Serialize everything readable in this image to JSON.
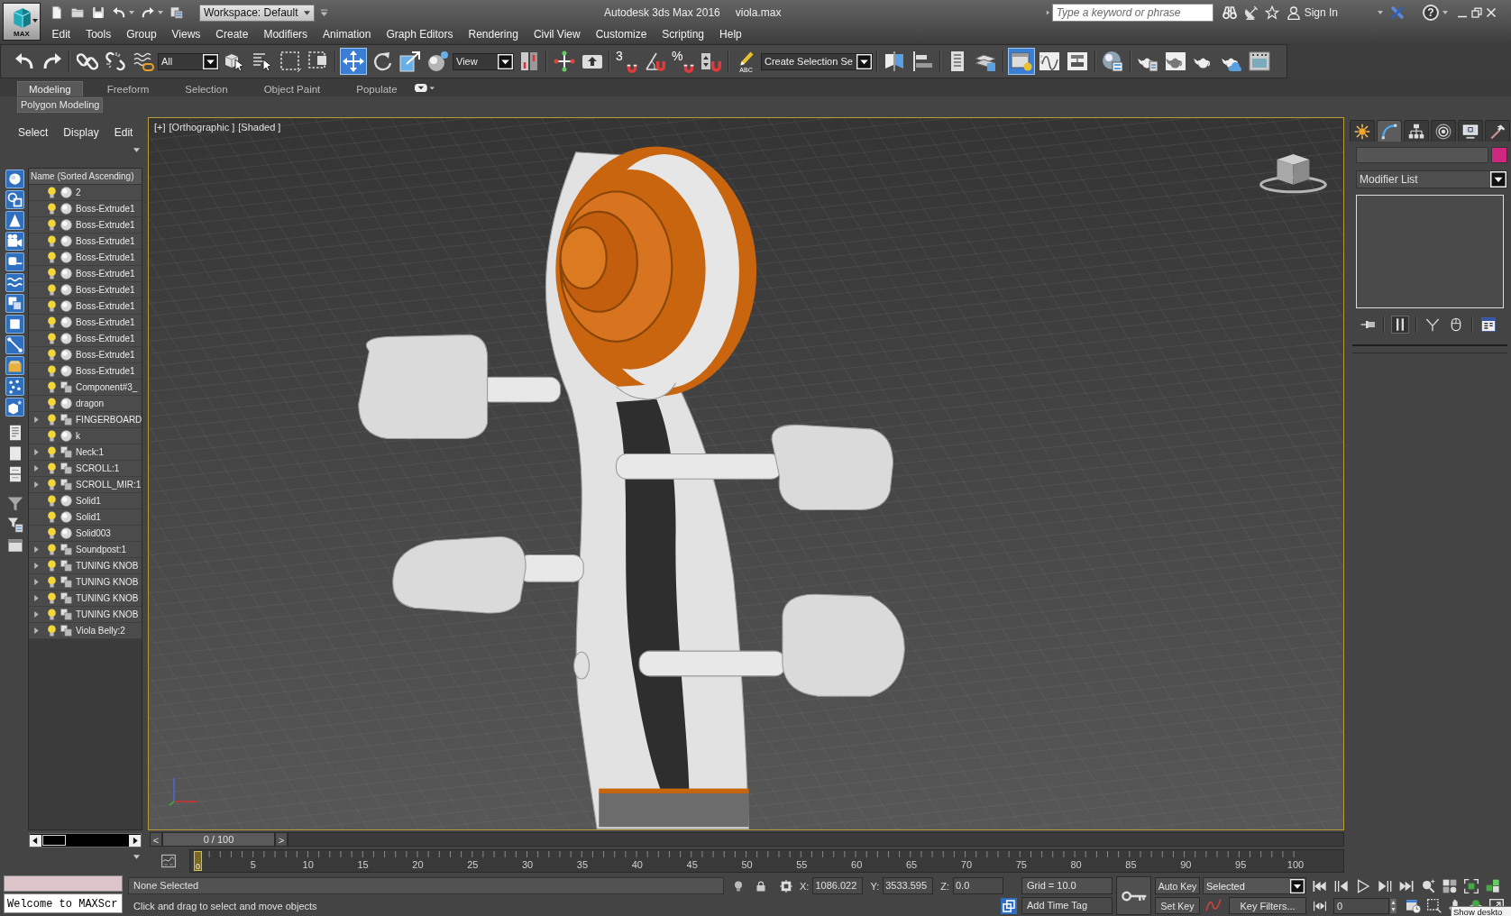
{
  "title_bar": {
    "app_button": "MAX",
    "workspace": "Workspace: Default",
    "app_title": "Autodesk 3ds Max 2016",
    "file_name": "viola.max",
    "search": {
      "placeholder": "Type a keyword or phrase"
    },
    "sign_in": "Sign In",
    "help": "?"
  },
  "menu_bar": [
    "Edit",
    "Tools",
    "Group",
    "Views",
    "Create",
    "Modifiers",
    "Animation",
    "Graph Editors",
    "Rendering",
    "Civil View",
    "Customize",
    "Scripting",
    "Help"
  ],
  "main_toolbar": {
    "groups": [
      [
        {
          "kind": "tool",
          "selected": false
        },
        {
          "kind": "tool",
          "selected": false
        }
      ],
      [
        {
          "kind": "tool",
          "selected": false
        },
        {
          "kind": "tool",
          "selected": false
        },
        {
          "kind": "tool",
          "selected": false
        },
        {
          "kind": "dropdown",
          "value": "All"
        },
        {
          "kind": "tool",
          "selected": false
        },
        {
          "kind": "tool",
          "selected": false
        },
        {
          "kind": "tool",
          "selected": false
        },
        {
          "kind": "tool",
          "selected": false
        }
      ],
      [
        {
          "kind": "tool",
          "selected": true
        },
        {
          "kind": "tool",
          "selected": false
        },
        {
          "kind": "tool",
          "selected": false
        },
        {
          "kind": "tool",
          "selected": false
        },
        {
          "kind": "dropdown",
          "value": "View"
        },
        {
          "kind": "tool",
          "selected": false
        }
      ],
      [
        {
          "kind": "tool",
          "selected": false
        },
        {
          "kind": "tool",
          "selected": false
        }
      ],
      [
        {
          "kind": "tool",
          "label": "3",
          "selected": false
        },
        {
          "kind": "tool",
          "selected": false
        },
        {
          "kind": "tool",
          "label": "%",
          "selected": false
        },
        {
          "kind": "tool",
          "selected": false
        }
      ],
      [
        {
          "kind": "tool",
          "label": "ABC",
          "selected": false
        },
        {
          "kind": "dropdown",
          "value": "Create Selection Se"
        }
      ],
      [
        {
          "kind": "tool",
          "selected": false
        },
        {
          "kind": "tool",
          "selected": false
        }
      ],
      [
        {
          "kind": "tool",
          "selected": false
        },
        {
          "kind": "tool",
          "selected": false
        }
      ],
      [
        {
          "kind": "tool",
          "selected": true
        },
        {
          "kind": "tool",
          "selected": false
        },
        {
          "kind": "tool",
          "selected": false
        }
      ],
      [
        {
          "kind": "tool",
          "selected": false
        }
      ],
      [
        {
          "kind": "tool",
          "selected": false
        },
        {
          "kind": "tool",
          "selected": false
        },
        {
          "kind": "tool",
          "selected": false
        },
        {
          "kind": "tool",
          "selected": false
        },
        {
          "kind": "tool",
          "selected": false
        }
      ]
    ]
  },
  "ribbon": {
    "tabs": [
      {
        "label": "Modeling",
        "selected": true
      },
      {
        "label": "Freeform",
        "selected": false
      },
      {
        "label": "Selection",
        "selected": false
      },
      {
        "label": "Object Paint",
        "selected": false
      },
      {
        "label": "Populate",
        "selected": false
      }
    ],
    "panel_tab": "Polygon Modeling"
  },
  "scene_explorer": {
    "menu": [
      "Select",
      "Display",
      "Edit"
    ],
    "display_filters": [
      {
        "on": true
      },
      {
        "on": true
      },
      {
        "on": true
      },
      {
        "on": true
      },
      {
        "on": true
      },
      {
        "on": true
      },
      {
        "on": true
      },
      {
        "on": true
      },
      {
        "on": true
      },
      {
        "on": true
      },
      {
        "on": true
      },
      {
        "on": true
      }
    ],
    "column_header": "Name (Sorted Ascending)",
    "rows": [
      {
        "name": "2",
        "kind": "object",
        "expandable": false,
        "visible": true
      },
      {
        "name": "Boss-Extrude1",
        "kind": "object",
        "expandable": false,
        "visible": true
      },
      {
        "name": "Boss-Extrude1",
        "kind": "object",
        "expandable": false,
        "visible": true
      },
      {
        "name": "Boss-Extrude1",
        "kind": "object",
        "expandable": false,
        "visible": true
      },
      {
        "name": "Boss-Extrude1",
        "kind": "object",
        "expandable": false,
        "visible": true
      },
      {
        "name": "Boss-Extrude1",
        "kind": "object",
        "expandable": false,
        "visible": true
      },
      {
        "name": "Boss-Extrude1",
        "kind": "object",
        "expandable": false,
        "visible": true
      },
      {
        "name": "Boss-Extrude1",
        "kind": "object",
        "expandable": false,
        "visible": true
      },
      {
        "name": "Boss-Extrude1",
        "kind": "object",
        "expandable": false,
        "visible": true
      },
      {
        "name": "Boss-Extrude1",
        "kind": "object",
        "expandable": false,
        "visible": true
      },
      {
        "name": "Boss-Extrude1",
        "kind": "object",
        "expandable": false,
        "visible": true
      },
      {
        "name": "Boss-Extrude1",
        "kind": "object",
        "expandable": false,
        "visible": true
      },
      {
        "name": "Component#3_",
        "kind": "group",
        "expandable": false,
        "visible": true
      },
      {
        "name": "dragon",
        "kind": "object",
        "expandable": false,
        "visible": true
      },
      {
        "name": "FINGERBOARD",
        "kind": "group",
        "expandable": true,
        "visible": true
      },
      {
        "name": "k",
        "kind": "object",
        "expandable": false,
        "visible": true
      },
      {
        "name": "Neck:1",
        "kind": "group",
        "expandable": true,
        "visible": true
      },
      {
        "name": "SCROLL:1",
        "kind": "group",
        "expandable": true,
        "visible": true
      },
      {
        "name": "SCROLL_MIR:1",
        "kind": "group",
        "expandable": true,
        "visible": true
      },
      {
        "name": "Solid1",
        "kind": "object",
        "expandable": false,
        "visible": true
      },
      {
        "name": "Solid1",
        "kind": "object",
        "expandable": false,
        "visible": true
      },
      {
        "name": "Solid003",
        "kind": "object",
        "expandable": false,
        "visible": true
      },
      {
        "name": "Soundpost:1",
        "kind": "group",
        "expandable": true,
        "visible": true
      },
      {
        "name": "TUNING KNOB",
        "kind": "group",
        "expandable": true,
        "visible": true
      },
      {
        "name": "TUNING KNOB",
        "kind": "group",
        "expandable": true,
        "visible": true
      },
      {
        "name": "TUNING KNOB",
        "kind": "group",
        "expandable": true,
        "visible": true
      },
      {
        "name": "TUNING KNOB",
        "kind": "group",
        "expandable": true,
        "visible": true
      },
      {
        "name": "Viola Belly:2",
        "kind": "group",
        "expandable": true,
        "visible": true
      }
    ]
  },
  "viewport": {
    "active": true,
    "labels": [
      "[+]",
      "[Orthographic ]",
      "[Shaded ]"
    ]
  },
  "time_slider": {
    "previous": "<",
    "position": "0 / 100",
    "next": ">"
  },
  "track_bar": {
    "current_frame": "0",
    "labels": [
      "5",
      "10",
      "15",
      "20",
      "25",
      "30",
      "35",
      "40",
      "45",
      "50",
      "55",
      "60",
      "65",
      "70",
      "75",
      "80",
      "85",
      "90",
      "95",
      "100"
    ]
  },
  "command_panel": {
    "tabs": [
      {
        "selected": false
      },
      {
        "selected": true
      },
      {
        "selected": false
      },
      {
        "selected": false
      },
      {
        "selected": false
      },
      {
        "selected": false
      }
    ],
    "modifier_list": "Modifier List",
    "stack_tools": [
      {
        "on": false
      },
      {
        "on": true
      },
      {
        "on": false
      },
      {
        "on": false
      },
      {
        "on": false
      }
    ]
  },
  "status_bar": {
    "listener_output": "Welcome to MAXScr",
    "selection": "None Selected",
    "prompt": "Click and drag to select and move objects",
    "coordinates": [
      {
        "axis": "X:",
        "value": "1086.022"
      },
      {
        "axis": "Y:",
        "value": "3533.595"
      },
      {
        "axis": "Z:",
        "value": "0.0"
      }
    ],
    "grid": "Grid = 10.0",
    "time_tag": "Add Time Tag"
  },
  "animation_controls": {
    "auto_key": "Auto Key",
    "set_key": "Set Key",
    "key_set": "Selected",
    "key_filters": "Key Filters...",
    "frame": "0"
  },
  "tooltip": "Show deskto"
}
